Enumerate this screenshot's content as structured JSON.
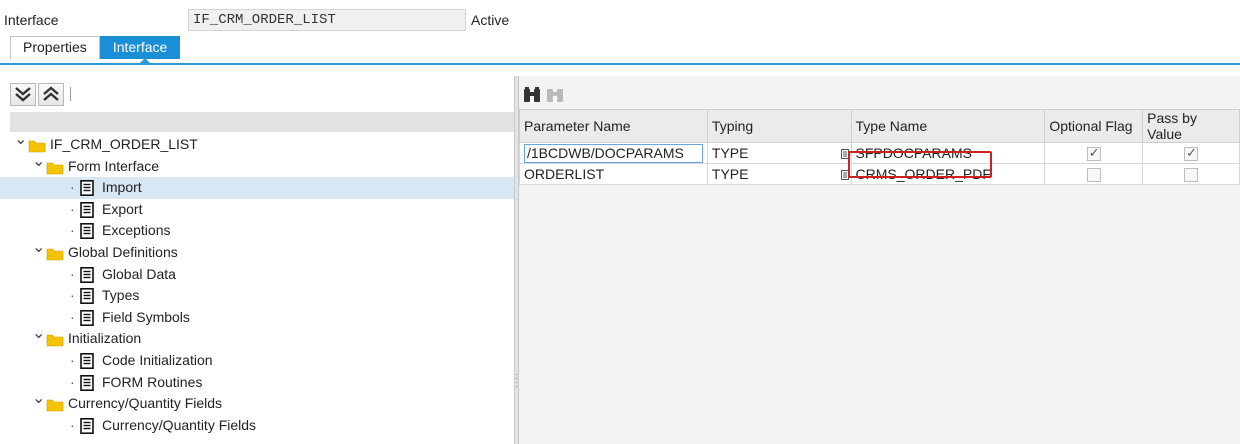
{
  "header": {
    "label": "Interface",
    "value": "IF_CRM_ORDER_LIST",
    "status": "Active"
  },
  "tabs": [
    {
      "label": "Properties",
      "active": false
    },
    {
      "label": "Interface",
      "active": true
    }
  ],
  "tree": [
    {
      "label": "IF_CRM_ORDER_LIST",
      "level": 0,
      "type": "folder",
      "expanded": true
    },
    {
      "label": "Form Interface",
      "level": 1,
      "type": "folder",
      "expanded": true
    },
    {
      "label": "Import",
      "level": 2,
      "type": "doc",
      "selected": true
    },
    {
      "label": "Export",
      "level": 2,
      "type": "doc"
    },
    {
      "label": "Exceptions",
      "level": 2,
      "type": "doc"
    },
    {
      "label": "Global Definitions",
      "level": 1,
      "type": "folder",
      "expanded": true
    },
    {
      "label": "Global Data",
      "level": 2,
      "type": "doc"
    },
    {
      "label": "Types",
      "level": 2,
      "type": "doc"
    },
    {
      "label": "Field Symbols",
      "level": 2,
      "type": "doc"
    },
    {
      "label": "Initialization",
      "level": 1,
      "type": "folder",
      "expanded": true
    },
    {
      "label": "Code Initialization",
      "level": 2,
      "type": "doc"
    },
    {
      "label": "FORM Routines",
      "level": 2,
      "type": "doc"
    },
    {
      "label": "Currency/Quantity Fields",
      "level": 1,
      "type": "folder",
      "expanded": true
    },
    {
      "label": "Currency/Quantity Fields",
      "level": 2,
      "type": "doc"
    }
  ],
  "grid": {
    "columns": [
      "Parameter Name",
      "Typing",
      "Type Name",
      "Optional Flag",
      "Pass by Value"
    ],
    "rows": [
      {
        "parameter": "/1BCDWB/DOCPARAMS",
        "typing": "TYPE",
        "type_name": "SFPDOCPARAMS",
        "optional": true,
        "pass_by_value": true
      },
      {
        "parameter": "ORDERLIST",
        "typing": "TYPE",
        "type_name": "CRMS_ORDER_PDF",
        "optional": false,
        "pass_by_value": false
      }
    ]
  },
  "icons": {
    "expand_all": "expand-all-icon",
    "collapse_all": "collapse-all-icon",
    "find": "binoculars-icon",
    "find_next": "find-next-icon",
    "folder": "folder-icon",
    "document": "document-icon",
    "value_help": "value-help-icon"
  },
  "colors": {
    "accent": "#1a8fd6",
    "selection": "#d7e7f3",
    "highlight_box": "#d01f1f",
    "folder": "#f5c400"
  }
}
